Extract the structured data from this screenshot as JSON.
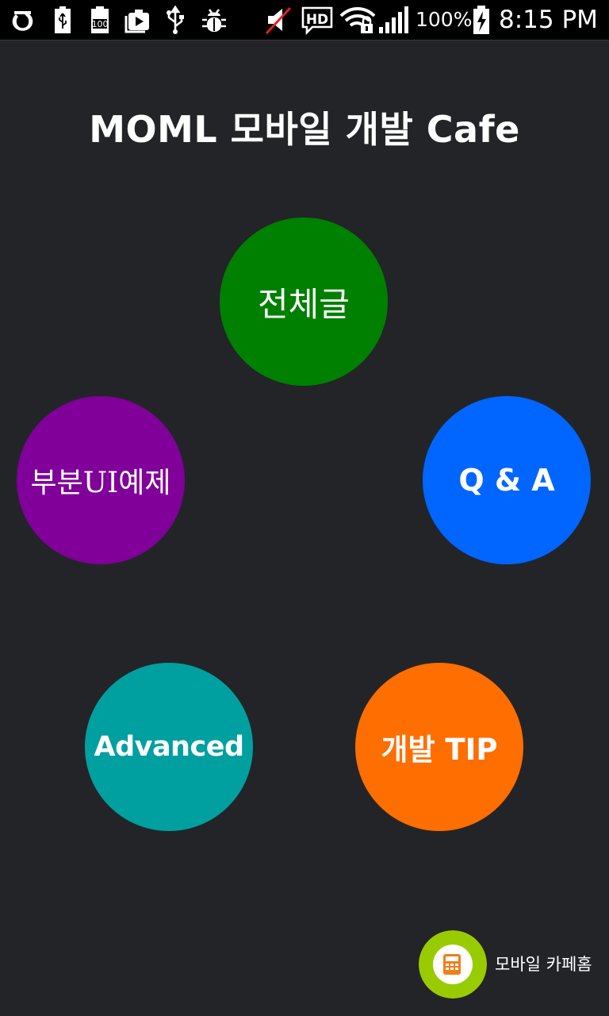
{
  "status_bar": {
    "battery_percent": "100%",
    "time": "8:15 PM",
    "hd_label": "HD",
    "storage_label": "100",
    "icons": [
      "carrier-logo-icon",
      "usb-battery-icon",
      "storage-100-icon",
      "media-upload-icon",
      "usb-icon",
      "debug-bug-icon",
      "mute-icon",
      "hd-voice-icon",
      "wifi-locked-icon",
      "cell-signal-icon",
      "battery-charging-icon"
    ]
  },
  "header": {
    "title": "MOML 모바일 개발 Cafe"
  },
  "menu": {
    "all_posts": {
      "label": "전체글",
      "color": "#008000"
    },
    "ui_examples": {
      "label": "부분UI예제",
      "color": "#800099"
    },
    "qa": {
      "label": "Q & A",
      "color": "#0066FF"
    },
    "advanced": {
      "label": "Advanced",
      "color": "#00A0A0"
    },
    "dev_tip": {
      "label": "개발 TIP",
      "color": "#FF6E00"
    }
  },
  "footer": {
    "cafe_home_label": "모바일 카페홈",
    "cafe_home_icon_color": "#99CC00",
    "cafe_home_icon_inner_color": "#F07F1A"
  }
}
